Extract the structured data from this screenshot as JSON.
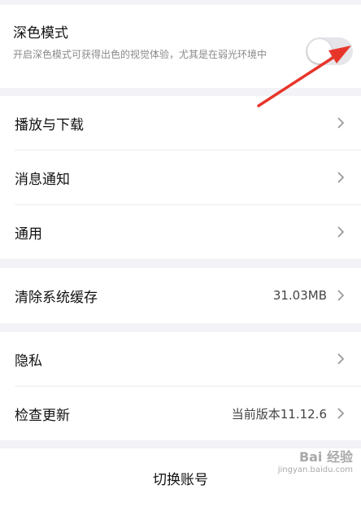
{
  "dark_mode": {
    "title": "深色模式",
    "description": "开启深色模式可获得出色的视觉体验，尤其是在弱光环境中",
    "enabled": false
  },
  "group1": {
    "items": [
      {
        "label": "播放与下载"
      },
      {
        "label": "消息通知"
      },
      {
        "label": "通用"
      }
    ]
  },
  "cache": {
    "label": "清除系统缓存",
    "value": "31.03MB"
  },
  "group3": {
    "privacy_label": "隐私",
    "update_label": "检查更新",
    "update_value": "当前版本11.12.6"
  },
  "switch_account": "切换账号",
  "watermark": {
    "text": "Bai 经验",
    "url": "jingyan.baidu.com"
  },
  "colors": {
    "arrow": "#e8352a",
    "background": "#f2f2f7"
  }
}
